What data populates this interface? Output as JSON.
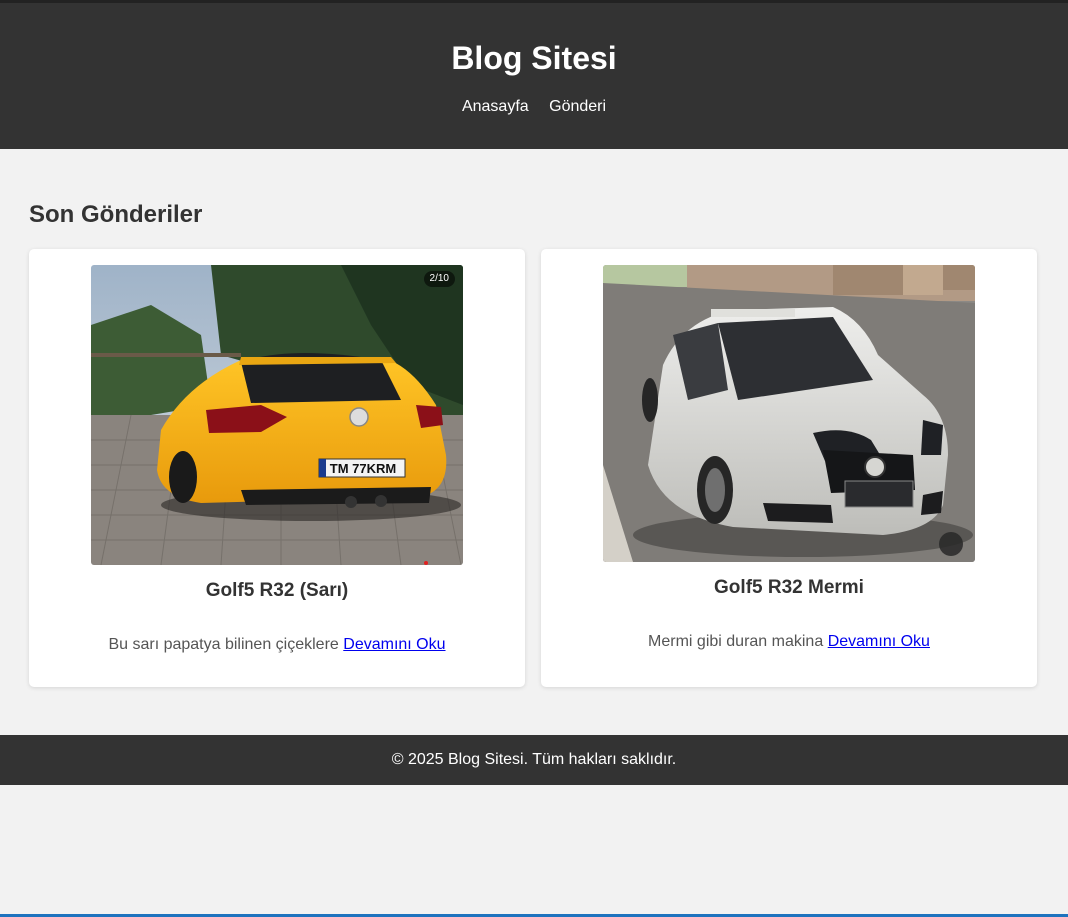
{
  "header": {
    "title": "Blog Sitesi",
    "nav": [
      {
        "label": "Anasayfa"
      },
      {
        "label": "Gönderi"
      }
    ]
  },
  "main": {
    "section_title": "Son Gönderiler",
    "posts": [
      {
        "title": "Golf5 R32 (Sarı)",
        "excerpt": "Bu sarı papatya bilinen çiçeklere",
        "link_label": "Devamını Oku",
        "image_badge": "2/10",
        "plate": "TM 77KRM",
        "car_color": "#f5b01a"
      },
      {
        "title": "Golf5 R32 Mermi",
        "excerpt": "Mermi gibi duran makina",
        "link_label": "Devamını Oku",
        "mute_icon": "mute-icon",
        "car_color": "#d9d9d6"
      }
    ]
  },
  "footer": {
    "text": "© 2025 Blog Sitesi. Tüm hakları saklıdır."
  },
  "colors": {
    "header_bg": "#333333",
    "page_bg": "#f2f2f2",
    "link": "#0000ee"
  }
}
